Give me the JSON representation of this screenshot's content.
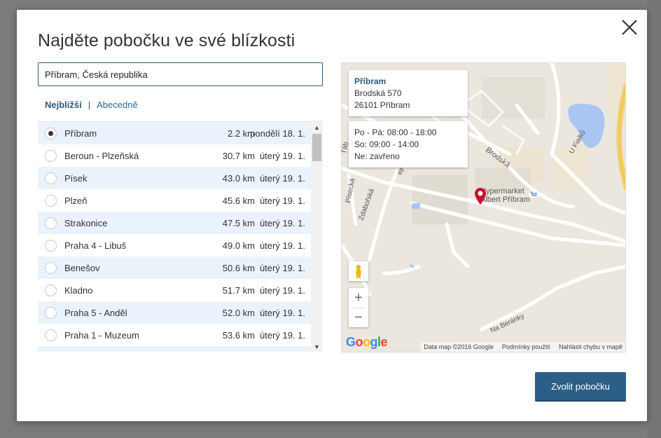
{
  "dialog": {
    "title": "Najděte pobočku ve své blízkosti",
    "search_value": "Příbram, Česká republika",
    "sort_active": "Nejbližší",
    "sort_separator": "|",
    "sort_other": "Abecedně",
    "choose_label": "Zvolit pobočku"
  },
  "branches": [
    {
      "name": "Příbram",
      "distance": "2.2 km",
      "date": "pondělí 18. 1.",
      "selected": true
    },
    {
      "name": "Beroun - Plzeňská",
      "distance": "30.7 km",
      "date": "úterý 19. 1.",
      "selected": false
    },
    {
      "name": "Písek",
      "distance": "43.0 km",
      "date": "úterý 19. 1.",
      "selected": false
    },
    {
      "name": "Plzeň",
      "distance": "45.6 km",
      "date": "úterý 19. 1.",
      "selected": false
    },
    {
      "name": "Strakonice",
      "distance": "47.5 km",
      "date": "úterý 19. 1.",
      "selected": false
    },
    {
      "name": "Praha 4 - Libuš",
      "distance": "49.0 km",
      "date": "úterý 19. 1.",
      "selected": false
    },
    {
      "name": "Benešov",
      "distance": "50.6 km",
      "date": "úterý 19. 1.",
      "selected": false
    },
    {
      "name": "Kladno",
      "distance": "51.7 km",
      "date": "úterý 19. 1.",
      "selected": false
    },
    {
      "name": "Praha 5 - Anděl",
      "distance": "52.0 km",
      "date": "úterý 19. 1.",
      "selected": false
    },
    {
      "name": "Praha 1 - Muzeum",
      "distance": "53.6 km",
      "date": "úterý 19. 1.",
      "selected": false
    }
  ],
  "map": {
    "info_title": "Příbram",
    "info_street": "Brodská 570",
    "info_city": "26101 Příbram",
    "hours_weekday": "Po - Pá: 08:00 - 18:00",
    "hours_saturday": "So: 09:00 - 14:00",
    "hours_sunday": "Ne: zavřeno",
    "label_brodska": "Brodská",
    "label_fialku": "U Fialků",
    "label_hypermarket_1": "Hypermarket",
    "label_hypermarket_2": "Albert Příbram",
    "label_piseckа": "Písecká",
    "label_zdaborska": "Zdabořská",
    "label_na_beranky": "Na Beránky",
    "label_tabor": "Táb",
    "label_vejl": "eji",
    "google_logo": "Google",
    "footer_data": "Data map ©2016 Google",
    "footer_terms": "Podmínky použití",
    "footer_report": "Nahlásit chybu v mapě",
    "zoom_in": "+",
    "zoom_out": "−",
    "accent_blue": "#2c5f88",
    "pin_color": "#c8102e"
  }
}
